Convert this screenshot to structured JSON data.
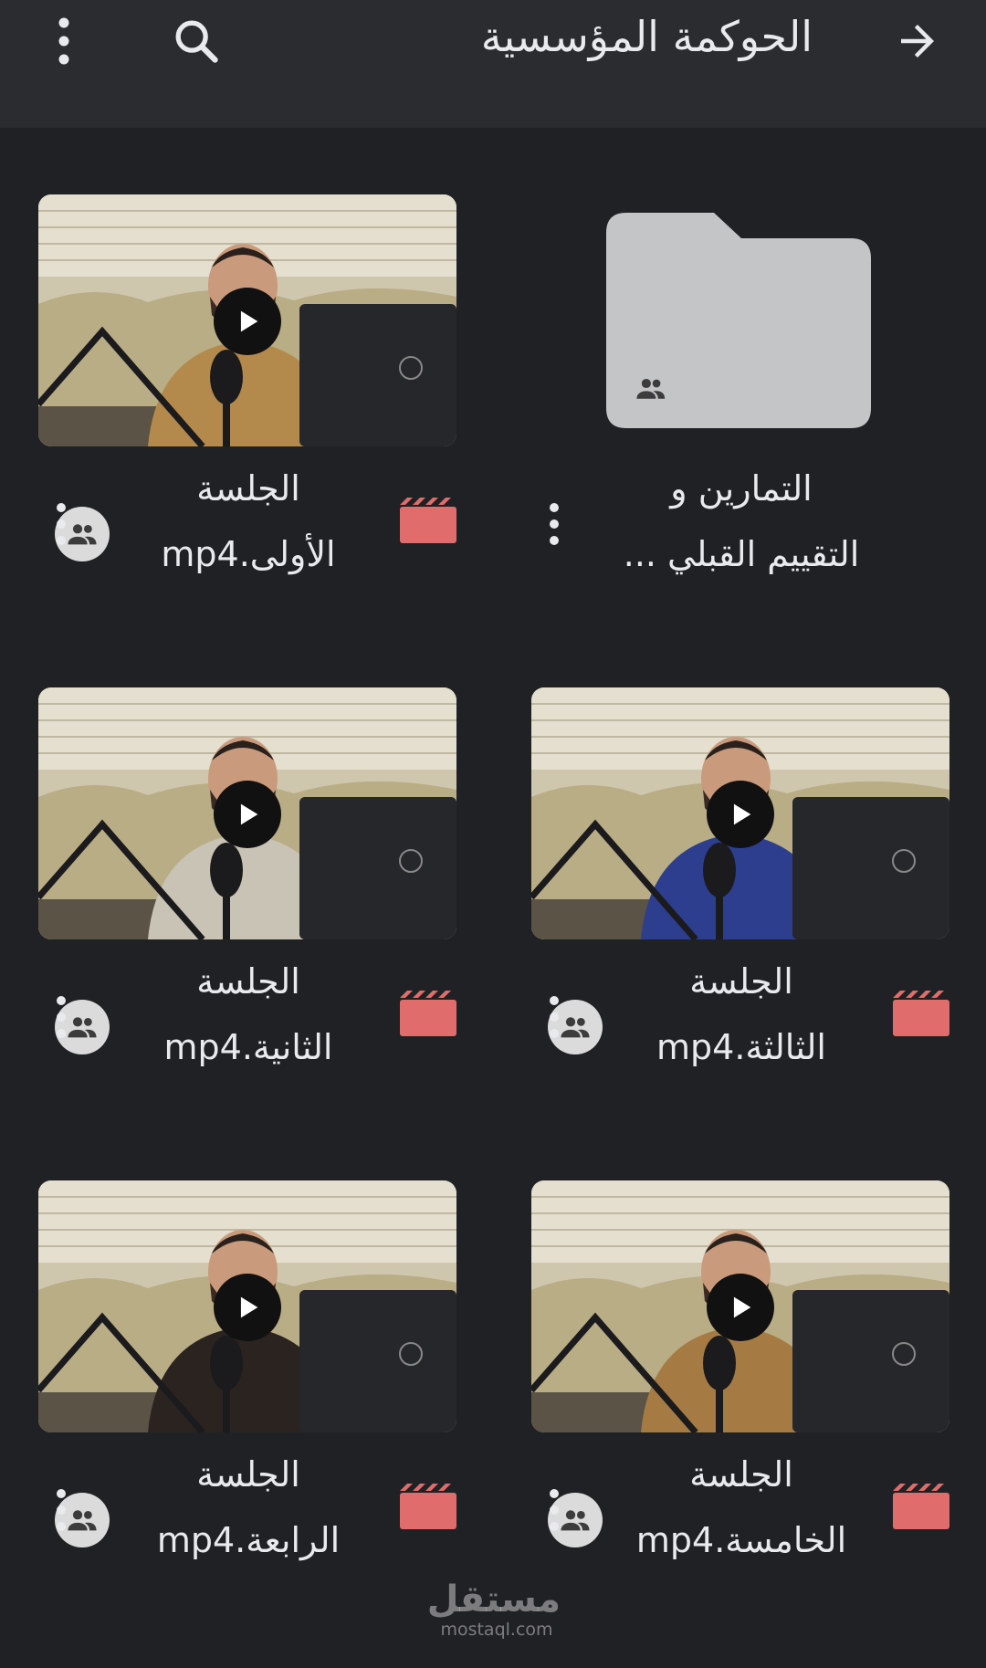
{
  "header": {
    "title": "الحوكمة المؤسسية",
    "back_icon": "arrow-right-icon",
    "search_icon": "search-icon",
    "menu_icon": "more-vertical-icon"
  },
  "items": [
    {
      "kind": "folder",
      "line1": "التمارين و",
      "line2": "التقييم القبلي ...",
      "shared": true
    },
    {
      "kind": "video",
      "line1": "الجلسة",
      "line2": "الأولى.mp4",
      "shared": true,
      "file_type": "video-file-icon",
      "type_color": "#e06c6c"
    },
    {
      "kind": "video",
      "line1": "الجلسة",
      "line2": "الثالثة.mp4",
      "shared": true,
      "file_type": "video-file-icon",
      "type_color": "#e06c6c"
    },
    {
      "kind": "video",
      "line1": "الجلسة",
      "line2": "الثانية.mp4",
      "shared": true,
      "file_type": "video-file-icon",
      "type_color": "#e06c6c"
    },
    {
      "kind": "video",
      "line1": "الجلسة",
      "line2": "الخامسة.mp4",
      "shared": true,
      "file_type": "video-file-icon",
      "type_color": "#e06c6c"
    },
    {
      "kind": "video",
      "line1": "الجلسة",
      "line2": "الرابعة.mp4",
      "shared": true,
      "file_type": "video-file-icon",
      "type_color": "#e06c6c"
    }
  ],
  "watermark": {
    "arabic": "مستقل",
    "latin": "mostaql.com"
  },
  "colors": {
    "background": "#202124",
    "appbar": "#2b2c2f",
    "folder": "#c4c5c7",
    "video_type": "#e06c6c"
  }
}
